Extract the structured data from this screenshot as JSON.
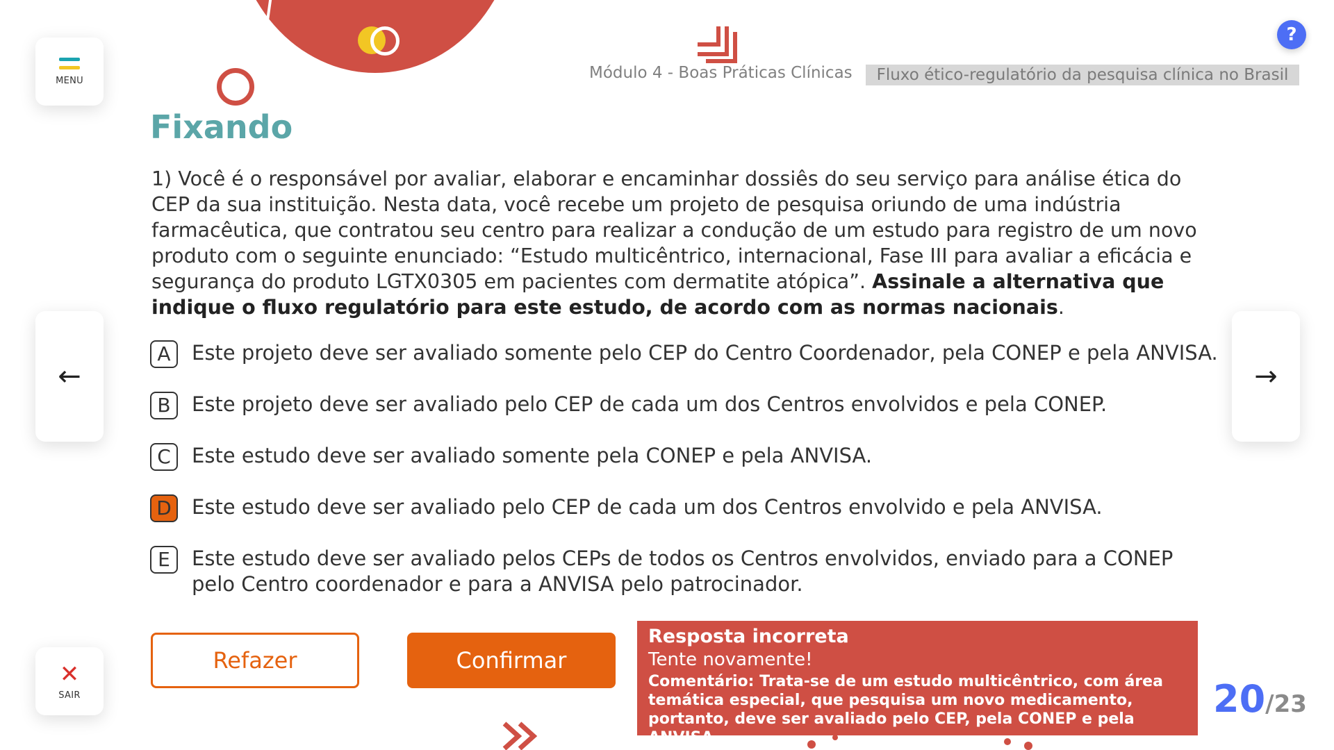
{
  "nav": {
    "menu_label": "MENU",
    "exit_label": "SAIR",
    "prev_icon": "arrow-left-icon",
    "next_icon": "arrow-right-icon",
    "help_label": "?"
  },
  "header": {
    "module": "Módulo 4 - Boas Práticas Clínicas",
    "topic": "Fluxo ético-regulatório da pesquisa clínica no Brasil"
  },
  "page_title": "Fixando",
  "question": {
    "text": "1) Você é o responsável por avaliar, elaborar e encaminhar dossiês do seu serviço para análise ética do CEP da sua instituição. Nesta data, você recebe um projeto de pesquisa oriundo de uma indústria farmacêutica, que contratou seu centro para realizar a condução de um estudo para registro de um novo produto com o seguinte enunciado: “Estudo multicêntrico, internacional, Fase III para avaliar a eficácia e segurança do produto LGTX0305 em pacientes com dermatite atópica”. ",
    "emphasis": "Assinale a alternativa que indique o fluxo regulatório para este estudo, de acordo com as normas nacionais",
    "end": "."
  },
  "options": [
    {
      "letter": "A",
      "text": "Este projeto deve ser avaliado somente pelo CEP do Centro Coordenador, pela CONEP e pela ANVISA.",
      "selected": false
    },
    {
      "letter": "B",
      "text": "Este projeto deve ser avaliado pelo CEP de cada um dos Centros envolvidos e pela CONEP.",
      "selected": false
    },
    {
      "letter": "C",
      "text": "Este estudo deve ser avaliado somente pela CONEP e pela ANVISA.",
      "selected": false
    },
    {
      "letter": "D",
      "text": "Este estudo deve ser avaliado pelo CEP de cada um dos Centros envolvido e pela ANVISA.",
      "selected": true
    },
    {
      "letter": "E",
      "text": "Este estudo deve ser avaliado pelos CEPs de todos os Centros envolvidos, enviado para a CONEP pelo Centro coordenador e para a ANVISA pelo patrocinador.",
      "selected": false
    }
  ],
  "actions": {
    "redo_label": "Refazer",
    "confirm_label": "Confirmar"
  },
  "feedback": {
    "title": "Resposta incorreta",
    "subtitle": "Tente novamente!",
    "comment": "Comentário: Trata-se de um estudo multicêntrico, com área temática especial, que pesquisa um novo medicamento, portanto, deve ser avaliado pelo CEP, pela CONEP e pela ANVISA."
  },
  "pagination": {
    "current": "20",
    "total": "/23"
  },
  "colors": {
    "accent_orange": "#e5620f",
    "feedback_red": "#cf4f44",
    "title_teal": "#5ba6a8",
    "help_blue": "#4d6ef5"
  }
}
